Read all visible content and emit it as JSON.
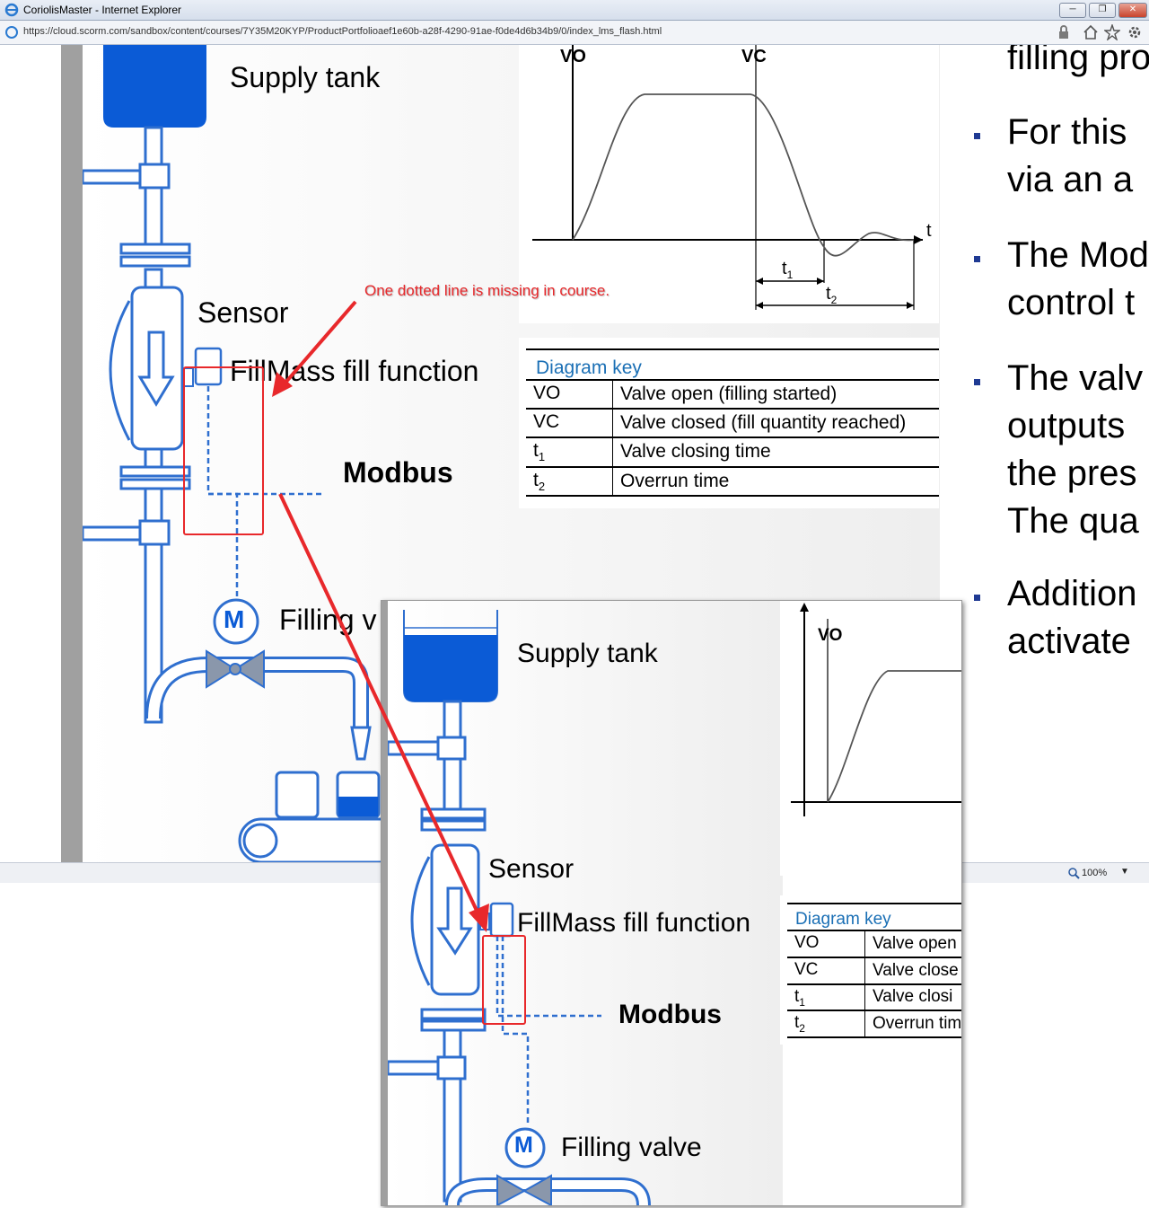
{
  "window": {
    "title": "CoriolisMaster - Internet Explorer",
    "minimize": "─",
    "restore": "❐",
    "close": "✕"
  },
  "address": {
    "url": "https://cloud.scorm.com/sandbox/content/courses/7Y35M20KYP/ProductPortfolioaef1e60b-a28f-4290-91ae-f0de4d6b34b9/0/index_lms_flash.html"
  },
  "diagram": {
    "supply_tank": "Supply tank",
    "sensor": "Sensor",
    "fillmass": "FillMass fill function",
    "modbus": "Modbus",
    "filling_valve": "Filling valve",
    "filling_valve_partial": "Filling v",
    "motor": "M",
    "vo": "VO",
    "vc": "VC",
    "t": "t",
    "t1": "t",
    "t1_sub": "1",
    "t2": "t",
    "t2_sub": "2"
  },
  "diagram_key": {
    "title": "Diagram key",
    "rows": [
      {
        "code": "VO",
        "sub": "",
        "desc": "Valve open (filling started)"
      },
      {
        "code": "VC",
        "sub": "",
        "desc": "Valve closed (fill quantity reached)"
      },
      {
        "code": "t",
        "sub": "1",
        "desc": "Valve closing time"
      },
      {
        "code": "t",
        "sub": "2",
        "desc": "Overrun time"
      }
    ]
  },
  "inset_key": {
    "title": "Diagram key",
    "rows": [
      {
        "code": "VO",
        "sub": "",
        "desc": "Valve open"
      },
      {
        "code": "VC",
        "sub": "",
        "desc": "Valve close"
      },
      {
        "code": "t",
        "sub": "1",
        "desc": "Valve closi"
      },
      {
        "code": "t",
        "sub": "2",
        "desc": "Overrun tim"
      }
    ]
  },
  "annotation": {
    "text": "One dotted line is missing in course.",
    "color": "#e8282b"
  },
  "bullets": [
    [
      "filling pro"
    ],
    [
      "For this",
      "via an a"
    ],
    [
      "The Mod",
      "control t"
    ],
    [
      "The valv",
      "outputs",
      "the pres",
      "The qua"
    ],
    [
      "Addition",
      "activate"
    ]
  ],
  "status": {
    "zoom": "100%"
  },
  "colors": {
    "accent_blue": "#0b5bd6",
    "line_blue": "#2f6fcf",
    "red": "#e8282b"
  }
}
